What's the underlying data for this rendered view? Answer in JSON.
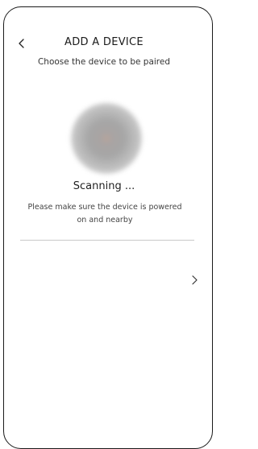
{
  "header": {
    "back_icon": "chevron-left-icon",
    "title": "ADD A DEVICE",
    "subtitle": "Choose the device to be paired"
  },
  "scan": {
    "status": "Scanning ...",
    "hint": "Please make sure the device is powered on and nearby"
  },
  "device_list": {
    "row_icon": "chevron-right-icon"
  }
}
